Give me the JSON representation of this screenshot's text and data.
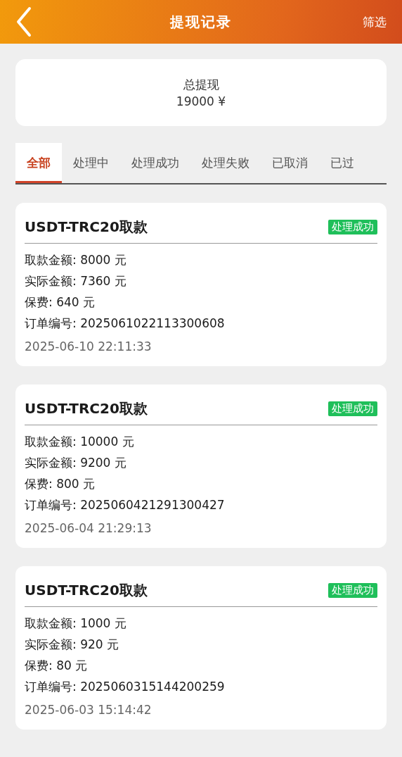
{
  "header": {
    "title": "提现记录",
    "action": "筛选"
  },
  "summary": {
    "label": "总提现",
    "value": "19000 ¥"
  },
  "tabs": [
    {
      "label": "全部",
      "selected": true
    },
    {
      "label": "处理中",
      "selected": false
    },
    {
      "label": "处理成功",
      "selected": false
    },
    {
      "label": "处理失败",
      "selected": false
    },
    {
      "label": "已取消",
      "selected": false
    },
    {
      "label": "已过",
      "selected": false
    }
  ],
  "records": [
    {
      "title": "USDT-TRC20取款",
      "status": "处理成功",
      "color": "#1fbf5a",
      "lines": [
        "取款金额: 8000 元",
        "实际金额: 7360 元",
        "保费: 640 元",
        "订单编号: 2025061022113300608"
      ],
      "time": "2025-06-10 22:11:33"
    },
    {
      "title": "USDT-TRC20取款",
      "status": "处理成功",
      "color": "#1fbf5a",
      "lines": [
        "取款金额: 10000 元",
        "实际金额: 9200 元",
        "保费: 800 元",
        "订单编号: 2025060421291300427"
      ],
      "time": "2025-06-04 21:29:13"
    },
    {
      "title": "USDT-TRC20取款",
      "status": "处理成功",
      "color": "#1fbf5a",
      "lines": [
        "取款金额: 1000 元",
        "实际金额: 920 元",
        "保费: 80 元",
        "订单编号: 2025060315144200259"
      ],
      "time": "2025-06-03 15:14:42"
    }
  ]
}
